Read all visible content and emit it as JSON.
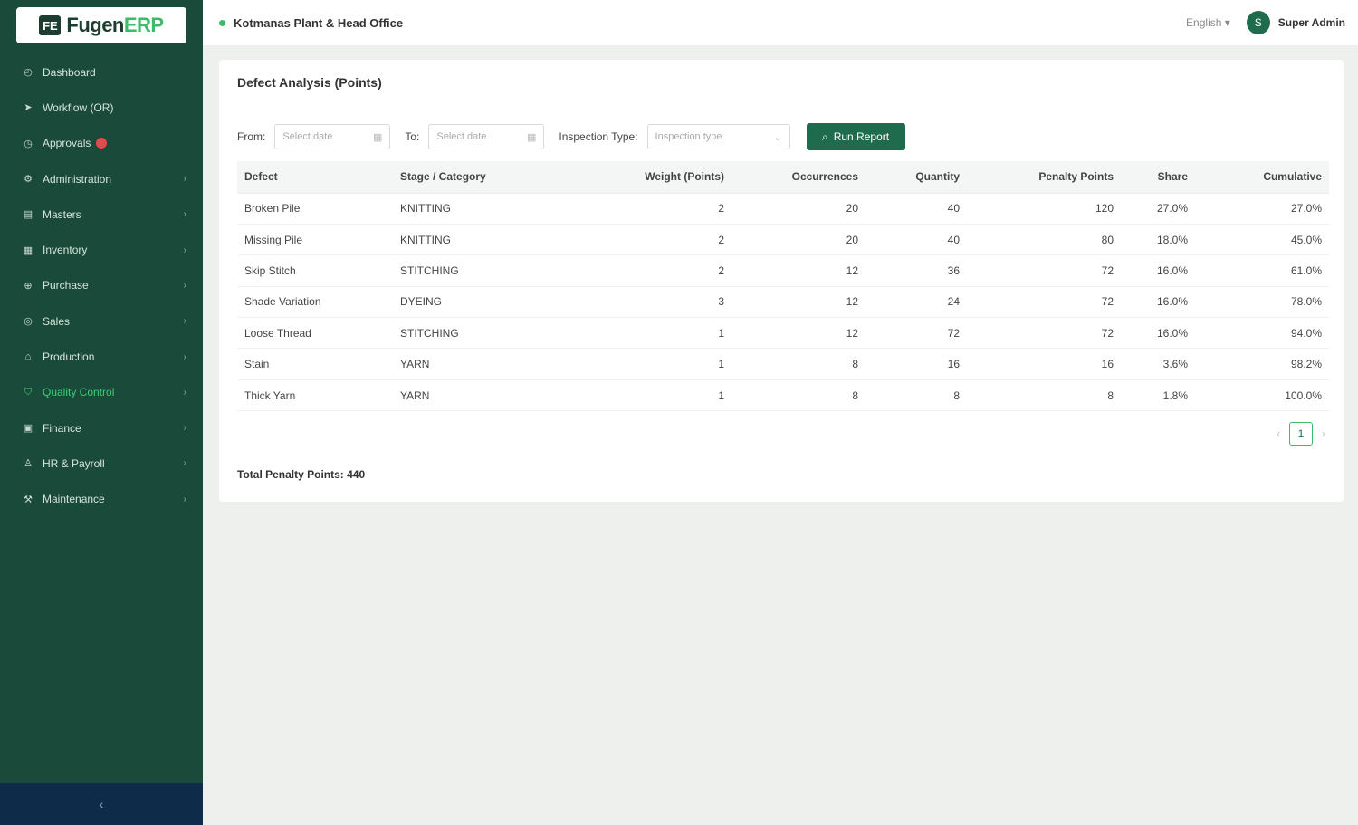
{
  "app": {
    "logo_text": "Fugen",
    "logo_accent": "ERP",
    "logo_mark": "FE"
  },
  "sidebar": {
    "items": [
      {
        "label": "Dashboard",
        "icon": "◴",
        "has_children": false
      },
      {
        "label": "Workflow (OR)",
        "icon": "➤",
        "has_children": false
      },
      {
        "label": "Approvals",
        "icon": "◷",
        "has_children": false,
        "badge": true
      },
      {
        "label": "Administration",
        "icon": "⚙",
        "has_children": true
      },
      {
        "label": "Masters",
        "icon": "▤",
        "has_children": true
      },
      {
        "label": "Inventory",
        "icon": "▦",
        "has_children": true
      },
      {
        "label": "Purchase",
        "icon": "⊕",
        "has_children": true
      },
      {
        "label": "Sales",
        "icon": "◎",
        "has_children": true
      },
      {
        "label": "Production",
        "icon": "⌂",
        "has_children": true
      },
      {
        "label": "Quality Control",
        "icon": "⛉",
        "has_children": true,
        "active": true
      },
      {
        "label": "Finance",
        "icon": "▣",
        "has_children": true
      },
      {
        "label": "HR & Payroll",
        "icon": "♙",
        "has_children": true
      },
      {
        "label": "Maintenance",
        "icon": "⚒",
        "has_children": true
      }
    ],
    "collapse_icon": "‹",
    "chevron": "›"
  },
  "header": {
    "title": "Kotmanas Plant & Head Office",
    "language": "English ▾",
    "avatar_initial": "S",
    "user_name": "Super Admin"
  },
  "report": {
    "title": "Defect Analysis (Points)",
    "from_label": "From:",
    "to_label": "To:",
    "date_placeholder": "Select date",
    "type_label": "Inspection Type:",
    "type_placeholder": "Inspection type",
    "run_button": "Run Report",
    "columns": [
      "Defect",
      "Stage / Category",
      "Weight (Points)",
      "Occurrences",
      "Quantity",
      "Penalty Points",
      "Share",
      "Cumulative"
    ],
    "rows": [
      [
        "Broken Pile",
        "KNITTING",
        "2",
        "20",
        "40",
        "120",
        "27.0%",
        "27.0%"
      ],
      [
        "Missing Pile",
        "KNITTING",
        "2",
        "20",
        "40",
        "80",
        "18.0%",
        "45.0%"
      ],
      [
        "Skip Stitch",
        "STITCHING",
        "2",
        "12",
        "36",
        "72",
        "16.0%",
        "61.0%"
      ],
      [
        "Shade Variation",
        "DYEING",
        "3",
        "12",
        "24",
        "72",
        "16.0%",
        "78.0%"
      ],
      [
        "Loose Thread",
        "STITCHING",
        "1",
        "12",
        "72",
        "72",
        "16.0%",
        "94.0%"
      ],
      [
        "Stain",
        "YARN",
        "1",
        "8",
        "16",
        "16",
        "3.6%",
        "98.2%"
      ],
      [
        "Thick Yarn",
        "YARN",
        "1",
        "8",
        "8",
        "8",
        "1.8%",
        "100.0%"
      ]
    ],
    "page_prev": "‹",
    "page_current": "1",
    "page_next": "›",
    "total_label": "Total Penalty Points: 440"
  },
  "colors": {
    "sidebar": "#1a4a3a",
    "accent": "#1e6b4e",
    "active": "#3dcc78",
    "footer": "#0f2b4a"
  }
}
